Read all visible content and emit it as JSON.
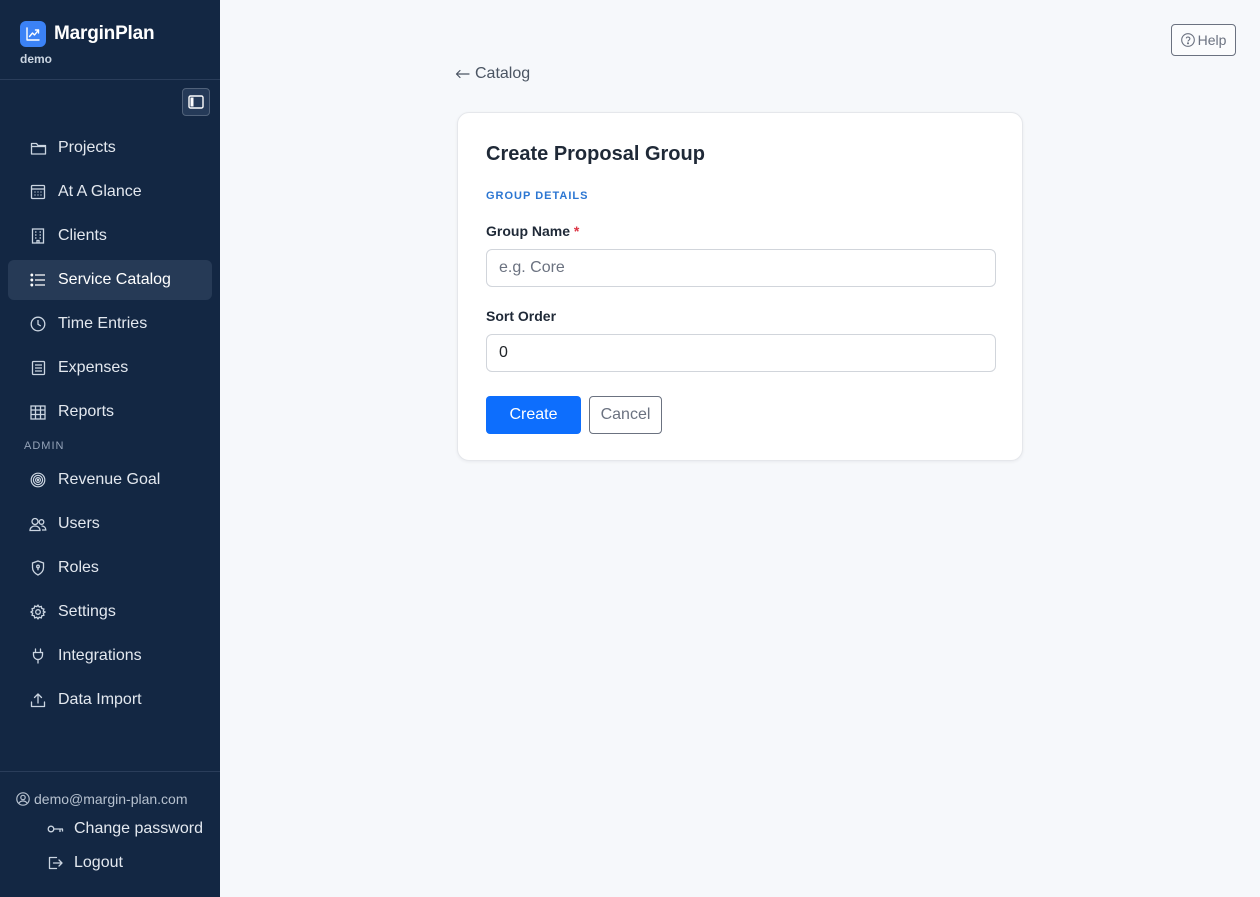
{
  "app": {
    "name": "MarginPlan",
    "tenant": "demo"
  },
  "sidebar": {
    "items": [
      {
        "label": "Projects",
        "icon": "folder-icon"
      },
      {
        "label": "At A Glance",
        "icon": "calendar-grid-icon"
      },
      {
        "label": "Clients",
        "icon": "building-icon"
      },
      {
        "label": "Service Catalog",
        "icon": "list-icon",
        "active": true
      },
      {
        "label": "Time Entries",
        "icon": "clock-icon"
      },
      {
        "label": "Expenses",
        "icon": "receipt-icon"
      },
      {
        "label": "Reports",
        "icon": "table-icon"
      }
    ],
    "admin_label": "ADMIN",
    "admin_items": [
      {
        "label": "Revenue Goal",
        "icon": "target-icon"
      },
      {
        "label": "Users",
        "icon": "users-icon"
      },
      {
        "label": "Roles",
        "icon": "shield-icon"
      },
      {
        "label": "Settings",
        "icon": "gear-icon"
      },
      {
        "label": "Integrations",
        "icon": "plug-icon"
      },
      {
        "label": "Data Import",
        "icon": "upload-icon"
      }
    ],
    "footer": {
      "email": "demo@margin-plan.com",
      "change_password": "Change password",
      "logout": "Logout"
    }
  },
  "header": {
    "help_label": "Help"
  },
  "breadcrumb": {
    "back_label": "Catalog"
  },
  "form": {
    "title": "Create Proposal Group",
    "section": "GROUP DETAILS",
    "group_name_label": "Group Name",
    "required_mark": "*",
    "group_name_placeholder": "e.g. Core",
    "group_name_value": "",
    "sort_order_label": "Sort Order",
    "sort_order_value": "0",
    "create_label": "Create",
    "cancel_label": "Cancel"
  },
  "colors": {
    "sidebar_bg": "#132743",
    "active_item_bg": "#263a56",
    "primary": "#0d6efd",
    "section_accent": "#2b76d2",
    "page_bg": "#f6f8fb"
  }
}
